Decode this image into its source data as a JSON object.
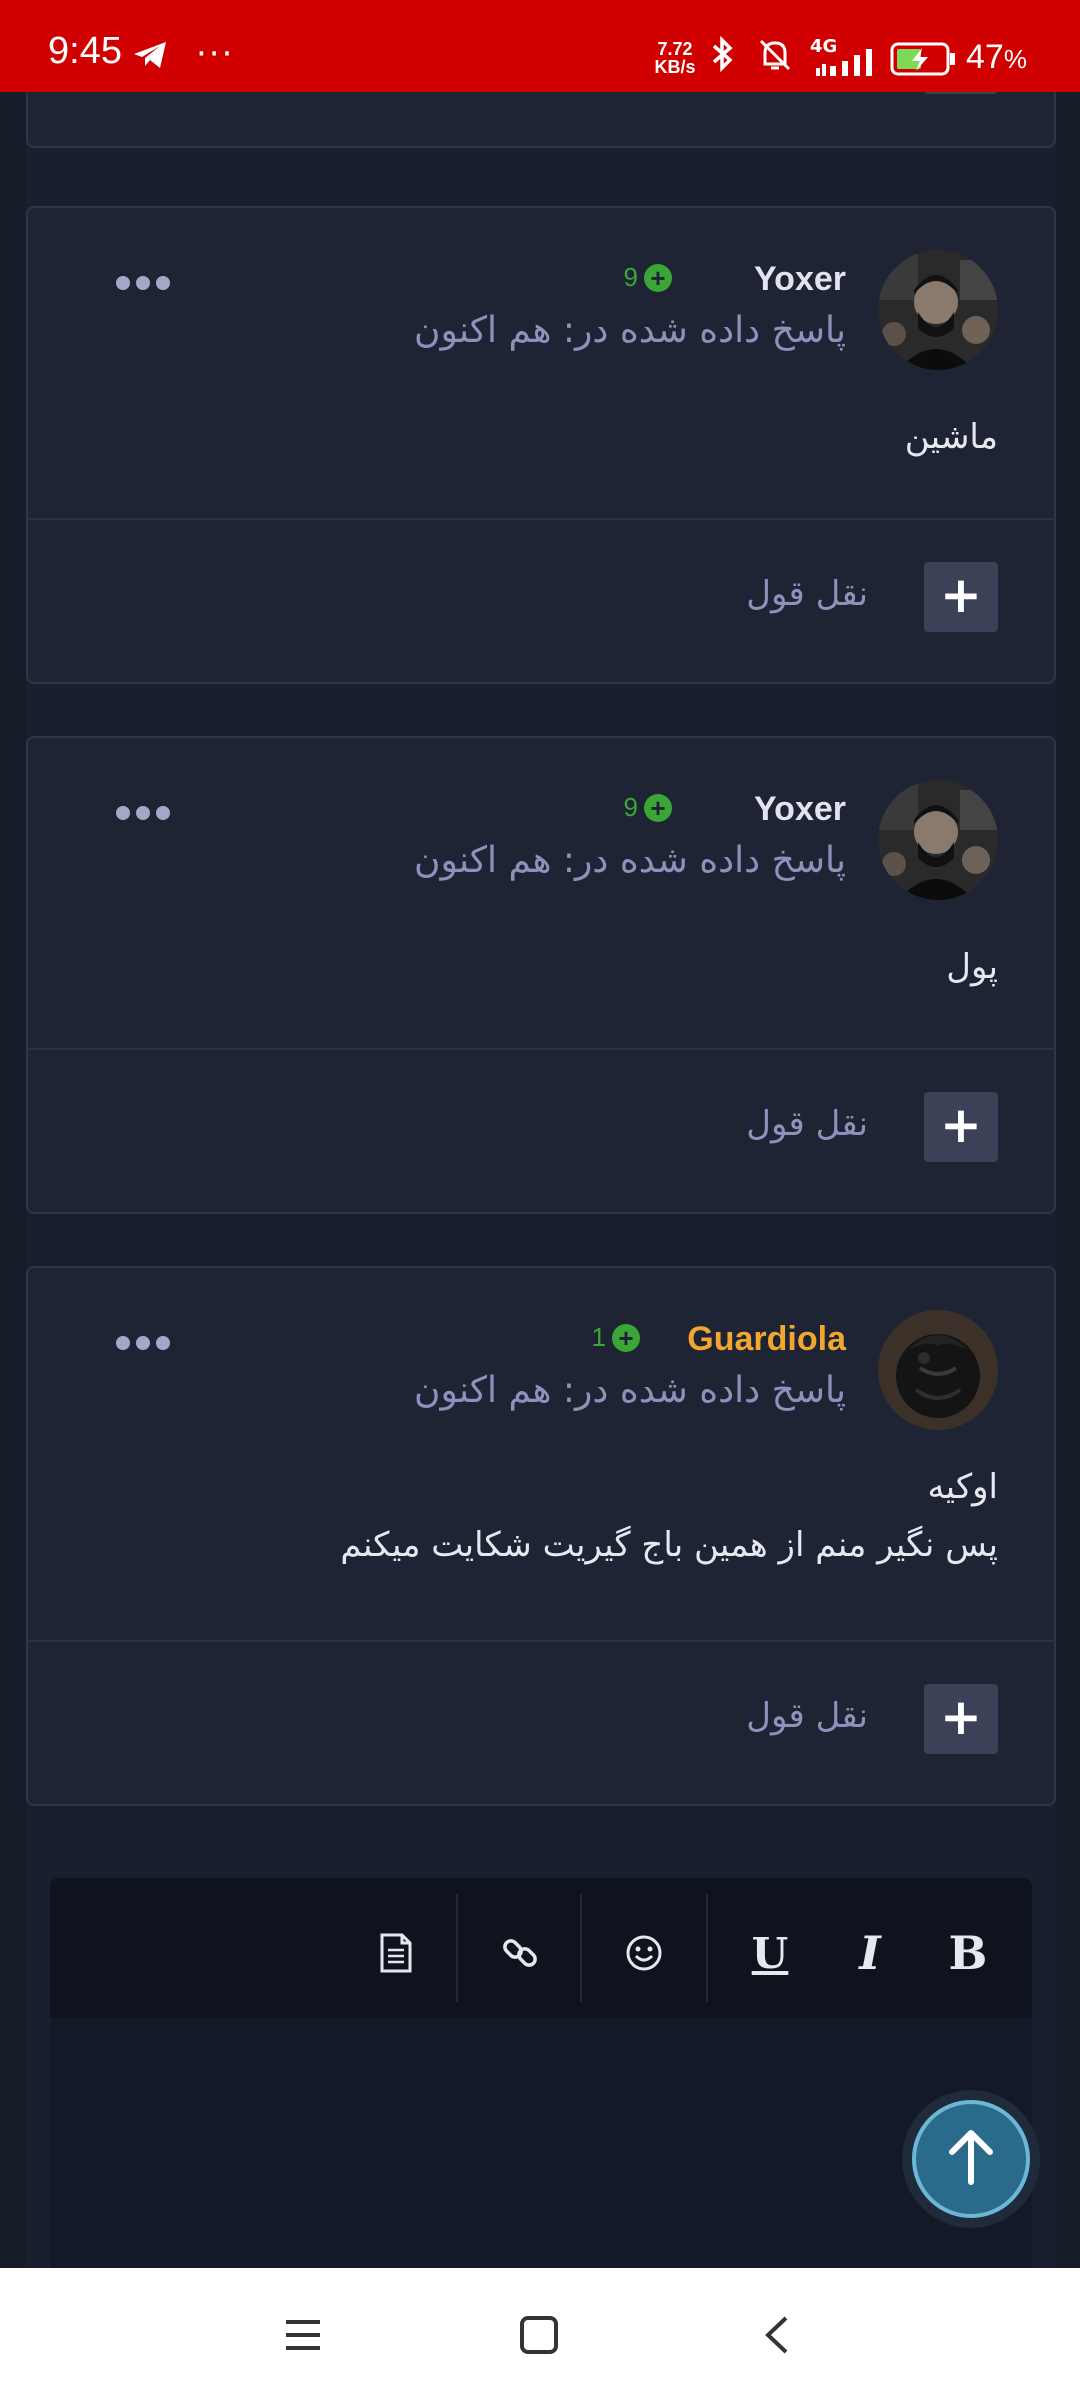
{
  "status_bar": {
    "time": "9:45",
    "more": "···",
    "net_speed_value": "7.72",
    "net_speed_unit": "KB/s",
    "network": "4G",
    "battery_percent": "47",
    "battery_sign": "%",
    "icons": [
      "telegram-icon",
      "bluetooth-icon",
      "mute-bell-icon",
      "signal-icon",
      "battery-charging-icon"
    ]
  },
  "posts": [
    {
      "author": "Yoxer",
      "reputation": "9",
      "replied": "پاسخ داده شده در: هم اکنون",
      "body": [
        "ماشین"
      ],
      "quote_label": "نقل قول"
    },
    {
      "author": "Yoxer",
      "reputation": "9",
      "replied": "پاسخ داده شده در: هم اکنون",
      "body": [
        "پول"
      ],
      "quote_label": "نقل قول"
    },
    {
      "author": "Guardiola",
      "reputation": "1",
      "replied": "پاسخ داده شده در: هم اکنون",
      "body": [
        "اوکیه",
        "پس نگیر منم از همین باج گیریت شکایت میکنم"
      ],
      "quote_label": "نقل قول"
    }
  ],
  "editor": {
    "tools": [
      "B",
      "I",
      "U",
      "emoji",
      "link",
      "source"
    ]
  },
  "colors": {
    "status_bar": "#d00000",
    "page_bg": "#161b27",
    "card_bg": "#1f2434",
    "reputation_green": "#3aa635",
    "gold_name": "#f0a630",
    "muted_text": "#8c92bb"
  }
}
